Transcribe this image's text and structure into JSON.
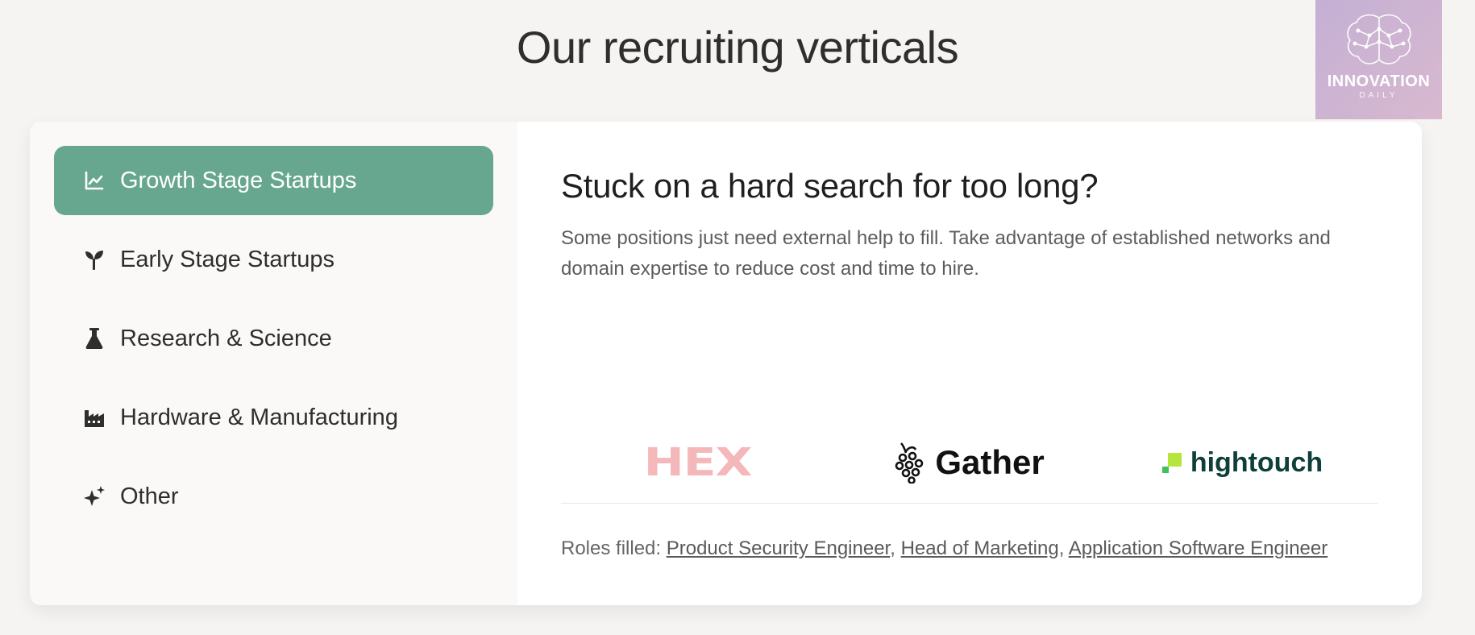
{
  "header": {
    "title": "Our recruiting verticals"
  },
  "watermark": {
    "title": "INNOVATION",
    "subtitle": "DAILY"
  },
  "sidebar": {
    "items": [
      {
        "label": "Growth Stage Startups",
        "icon": "chart-line-icon",
        "active": true
      },
      {
        "label": "Early Stage Startups",
        "icon": "sprout-icon",
        "active": false
      },
      {
        "label": "Research & Science",
        "icon": "flask-icon",
        "active": false
      },
      {
        "label": "Hardware & Manufacturing",
        "icon": "factory-icon",
        "active": false
      },
      {
        "label": "Other",
        "icon": "sparkles-icon",
        "active": false
      }
    ]
  },
  "main": {
    "heading": "Stuck on a hard search for too long?",
    "description": "Some positions just need external help to fill. Take advantage of established networks and domain expertise to reduce cost and time to hire.",
    "logos": [
      {
        "name": "HEX",
        "color": "#f4b8bb"
      },
      {
        "name": "Gather",
        "color": "#111111"
      },
      {
        "name": "hightouch",
        "color": "#0f3f3b"
      }
    ],
    "roles_label": "Roles filled:",
    "roles": [
      "Product Security Engineer",
      "Head of Marketing",
      "Application Software Engineer"
    ],
    "roles_separator": ","
  },
  "colors": {
    "accent": "#68a78f",
    "background": "#f5f4f2"
  }
}
